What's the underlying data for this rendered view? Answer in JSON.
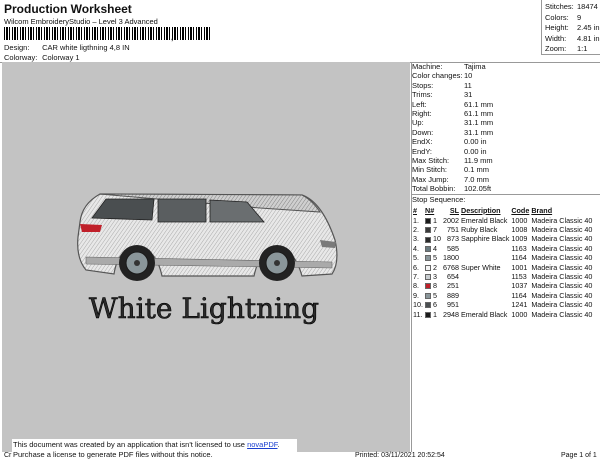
{
  "header": {
    "title": "Production Worksheet",
    "subtitle": "Wilcom EmbroideryStudio – Level 3 Advanced",
    "barcode_tail": ",",
    "design_label": "Design:",
    "design_value": "CAR white ligthning 4,8 IN",
    "colorway_label": "Colorway:",
    "colorway_value": "Colorway 1"
  },
  "stats": [
    {
      "k": "Stitches:",
      "v": "18474"
    },
    {
      "k": "Colors:",
      "v": "9"
    },
    {
      "k": "Height:",
      "v": "2.45 in"
    },
    {
      "k": "Width:",
      "v": "4.81 in"
    },
    {
      "k": "Zoom:",
      "v": "1:1"
    }
  ],
  "machine": [
    {
      "k": "Machine:",
      "v": "Tajima"
    },
    {
      "k": "Color changes:",
      "v": "10"
    },
    {
      "k": "Stops:",
      "v": "11"
    },
    {
      "k": "Trims:",
      "v": "31"
    },
    {
      "k": "Left:",
      "v": "61.1 mm"
    },
    {
      "k": "Right:",
      "v": "61.1 mm"
    },
    {
      "k": "Up:",
      "v": "31.1 mm"
    },
    {
      "k": "Down:",
      "v": "31.1 mm"
    },
    {
      "k": "EndX:",
      "v": "0.00 in"
    },
    {
      "k": "EndY:",
      "v": "0.00 in"
    },
    {
      "k": "Max Stitch:",
      "v": "11.9 mm"
    },
    {
      "k": "Min Stitch:",
      "v": "0.1 mm"
    },
    {
      "k": "Max Jump:",
      "v": "7.0 mm"
    },
    {
      "k": "Total Bobbin:",
      "v": "102.05ft"
    }
  ],
  "sequence": {
    "title": "Stop Sequence:",
    "headers": [
      "#",
      "N#",
      "SL",
      "Description",
      "Code",
      "Brand"
    ],
    "rows": [
      {
        "n": "1.",
        "nn": "1",
        "color": "#1a1a1a",
        "sl": "2002",
        "desc": "Emerald Black",
        "code": "1000",
        "brand": "Madeira Classic 40"
      },
      {
        "n": "2.",
        "nn": "7",
        "color": "#3a3a3a",
        "sl": "751",
        "desc": "Ruby Black",
        "code": "1008",
        "brand": "Madeira Classic 40"
      },
      {
        "n": "3.",
        "nn": "10",
        "color": "#2a2a2a",
        "sl": "873",
        "desc": "Sapphire Black",
        "code": "1009",
        "brand": "Madeira Classic 40"
      },
      {
        "n": "4.",
        "nn": "4",
        "color": "#6a7a80",
        "sl": "585",
        "desc": "",
        "code": "1163",
        "brand": "Madeira Classic 40"
      },
      {
        "n": "5.",
        "nn": "5",
        "color": "#8a969a",
        "sl": "1800",
        "desc": "",
        "code": "1164",
        "brand": "Madeira Classic 40"
      },
      {
        "n": "6.",
        "nn": "2",
        "color": "#f4f4f4",
        "sl": "6768",
        "desc": "Super White",
        "code": "1001",
        "brand": "Madeira Classic 40"
      },
      {
        "n": "7.",
        "nn": "3",
        "color": "#c8cdd0",
        "sl": "654",
        "desc": "",
        "code": "1153",
        "brand": "Madeira Classic 40"
      },
      {
        "n": "8.",
        "nn": "8",
        "color": "#c0202a",
        "sl": "251",
        "desc": "",
        "code": "1037",
        "brand": "Madeira Classic 40"
      },
      {
        "n": "9.",
        "nn": "5",
        "color": "#8a969a",
        "sl": "889",
        "desc": "",
        "code": "1164",
        "brand": "Madeira Classic 40"
      },
      {
        "n": "10.",
        "nn": "6",
        "color": "#4a4e50",
        "sl": "951",
        "desc": "",
        "code": "1241",
        "brand": "Madeira Classic 40"
      },
      {
        "n": "11.",
        "nn": "1",
        "color": "#1a1a1a",
        "sl": "2948",
        "desc": "Emerald Black",
        "code": "1000",
        "brand": "Madeira Classic 40"
      }
    ]
  },
  "design_text": "White Lightning",
  "notice": {
    "line1": "This document was created by an application that isn't licensed to use ",
    "link": "novaPDF",
    "line1_end": ".",
    "line2": "Purchase a license to generate PDF files without this notice."
  },
  "footer": {
    "left": "Cr",
    "printed": "Printed: 03/11/2021 20:52:54",
    "page": "Page 1 of 1"
  }
}
